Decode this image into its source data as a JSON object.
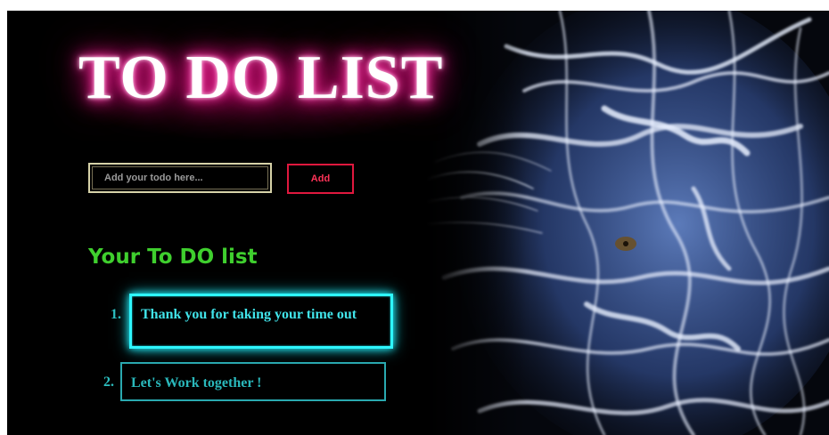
{
  "header": {
    "title": "TO DO LIST"
  },
  "form": {
    "input_placeholder": "Add your todo here...",
    "input_value": "",
    "add_label": "Add"
  },
  "list": {
    "heading": "Your To DO list",
    "items": [
      {
        "number": "1.",
        "text": "Thank you for taking your time out",
        "highlighted": true
      },
      {
        "number": "2.",
        "text": "Let's Work together !",
        "highlighted": false
      }
    ]
  },
  "colors": {
    "background": "#000000",
    "title_glow": "#ff2a9c",
    "input_border": "#d6d2a8",
    "add_button": "#e0183e",
    "heading": "#3fcf2e",
    "item_accent": "#2ef6ff",
    "item_text": "#2ec9cc"
  },
  "icons": {
    "background_art": "tiger-face-illustration"
  }
}
